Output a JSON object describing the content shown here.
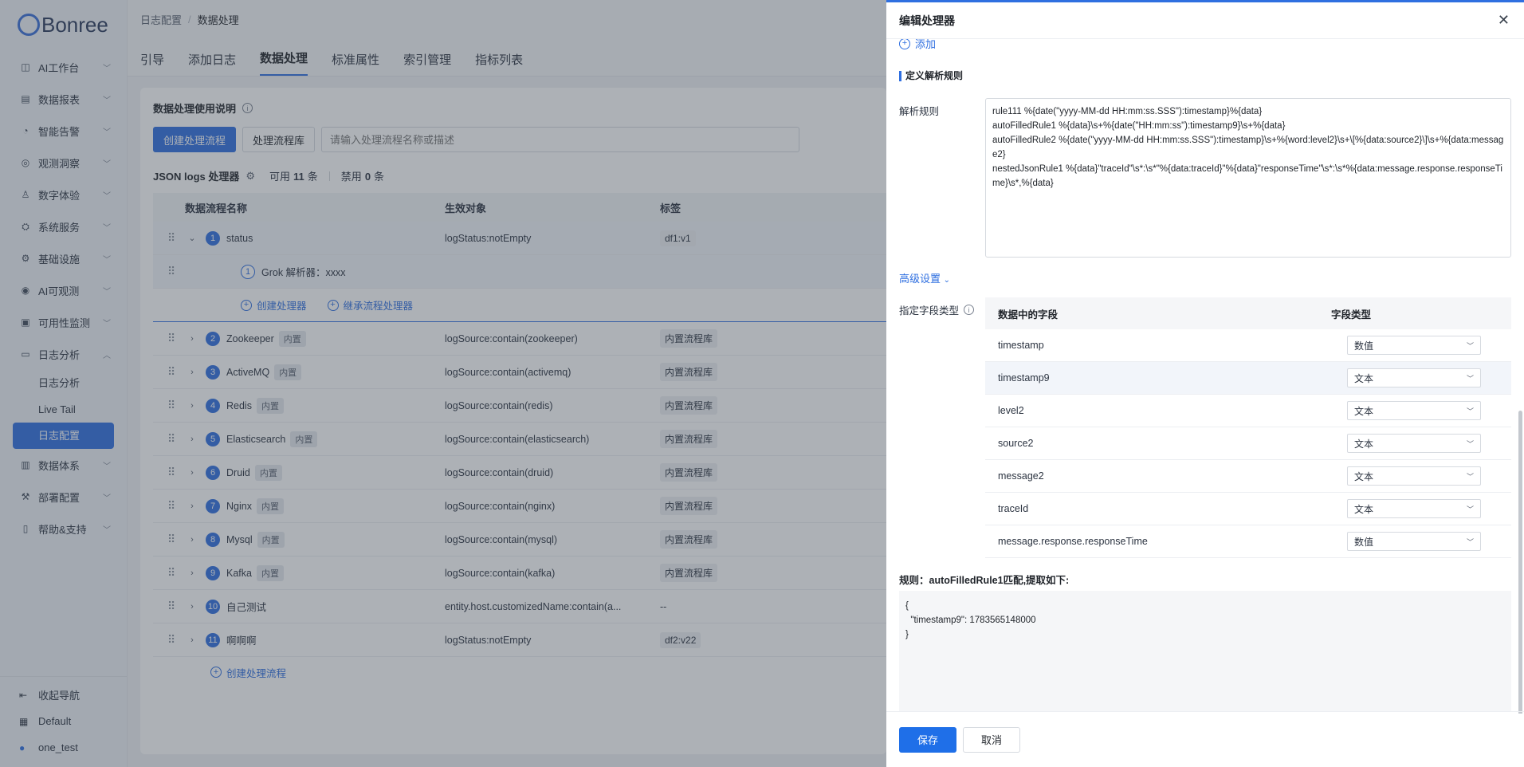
{
  "brand": "Bonree",
  "sidebar": {
    "items": [
      {
        "label": "AI工作台",
        "icon": "ai-workbench-icon"
      },
      {
        "label": "数据报表",
        "icon": "report-icon"
      },
      {
        "label": "智能告警",
        "icon": "alert-icon"
      },
      {
        "label": "观测洞察",
        "icon": "insight-icon"
      },
      {
        "label": "数字体验",
        "icon": "experience-icon"
      },
      {
        "label": "系统服务",
        "icon": "service-icon"
      },
      {
        "label": "基础设施",
        "icon": "infrastructure-icon"
      },
      {
        "label": "AI可观测",
        "icon": "ai-observe-icon"
      },
      {
        "label": "可用性监测",
        "icon": "availability-icon"
      },
      {
        "label": "日志分析",
        "icon": "log-icon"
      }
    ],
    "log_sub": [
      "日志分析",
      "Live Tail",
      "日志配置"
    ],
    "items_after": [
      {
        "label": "数据体系",
        "icon": "data-system-icon"
      },
      {
        "label": "部署配置",
        "icon": "deploy-icon"
      },
      {
        "label": "帮助&支持",
        "icon": "help-icon"
      }
    ],
    "collapse": "收起导航",
    "workspace": "Default",
    "user": "one_test"
  },
  "breadcrumb": {
    "parent": "日志配置",
    "current": "数据处理"
  },
  "tabs": [
    "引导",
    "添加日志",
    "数据处理",
    "标准属性",
    "索引管理",
    "指标列表"
  ],
  "card": {
    "title": "数据处理使用说明",
    "create_flow": "创建处理流程",
    "flow_lib": "处理流程库",
    "search_placeholder": "请输入处理流程名称或描述",
    "processor_title": "JSON logs 处理器",
    "enabled_label": "可用",
    "enabled_count": "11",
    "enabled_unit": "条",
    "disabled_label": "禁用",
    "disabled_count": "0",
    "disabled_unit": "条"
  },
  "table": {
    "headers": [
      "数据流程名称",
      "生效对象",
      "标签"
    ],
    "first": {
      "num": "1",
      "name": "status",
      "target": "logStatus:notEmpty",
      "tag": "df1:v1"
    },
    "child": {
      "num": "1",
      "name": "Grok 解析器：xxxx"
    },
    "child_actions": [
      "创建处理器",
      "继承流程处理器"
    ],
    "rows": [
      {
        "num": "2",
        "name": "Zookeeper",
        "badge": "内置",
        "target": "logSource:contain(zookeeper)",
        "tag": "内置流程库"
      },
      {
        "num": "3",
        "name": "ActiveMQ",
        "badge": "内置",
        "target": "logSource:contain(activemq)",
        "tag": "内置流程库"
      },
      {
        "num": "4",
        "name": "Redis",
        "badge": "内置",
        "target": "logSource:contain(redis)",
        "tag": "内置流程库"
      },
      {
        "num": "5",
        "name": "Elasticsearch",
        "badge": "内置",
        "target": "logSource:contain(elasticsearch)",
        "tag": "内置流程库"
      },
      {
        "num": "6",
        "name": "Druid",
        "badge": "内置",
        "target": "logSource:contain(druid)",
        "tag": "内置流程库"
      },
      {
        "num": "7",
        "name": "Nginx",
        "badge": "内置",
        "target": "logSource:contain(nginx)",
        "tag": "内置流程库"
      },
      {
        "num": "8",
        "name": "Mysql",
        "badge": "内置",
        "target": "logSource:contain(mysql)",
        "tag": "内置流程库"
      },
      {
        "num": "9",
        "name": "Kafka",
        "badge": "内置",
        "target": "logSource:contain(kafka)",
        "tag": "内置流程库"
      },
      {
        "num": "10",
        "name": "自己测试",
        "badge": "",
        "target": "entity.host.customizedName:contain(a...",
        "tag": "--"
      },
      {
        "num": "11",
        "name": "啊啊啊",
        "badge": "",
        "target": "logStatus:notEmpty",
        "tag": "df2:v22"
      }
    ],
    "create_flow": "创建处理流程"
  },
  "drawer": {
    "title": "编辑处理器",
    "add": "添加",
    "section": "定义解析规则",
    "rules_label": "解析规则",
    "rules": "rule111 %{date(\"yyyy-MM-dd HH:mm:ss.SSS\"):timestamp}%{data}\nautoFilledRule1 %{data}\\s+%{date(\"HH:mm:ss\"):timestamp9}\\s+%{data}\nautoFilledRule2 %{date(\"yyyy-MM-dd HH:mm:ss.SSS\"):timestamp}\\s+%{word:level2}\\s+\\[%{data:source2}\\]\\s+%{data:message2}\nnestedJsonRule1 %{data}\"traceId\"\\s*:\\s*\"%{data:traceId}\"%{data}\"responseTime\"\\s*:\\s*%{data:message.response.responseTime}\\s*,%{data}",
    "advanced": "高级设置",
    "field_type_label": "指定字段类型",
    "field_headers": [
      "数据中的字段",
      "字段类型"
    ],
    "fields": [
      {
        "name": "timestamp",
        "type": "数值"
      },
      {
        "name": "timestamp9",
        "type": "文本"
      },
      {
        "name": "level2",
        "type": "文本"
      },
      {
        "name": "source2",
        "type": "文本"
      },
      {
        "name": "message2",
        "type": "文本"
      },
      {
        "name": "traceId",
        "type": "文本"
      },
      {
        "name": "message.response.responseTime",
        "type": "数值"
      }
    ],
    "result_label": "规则：autoFilledRule1匹配,提取如下:",
    "result": "{\n  \"timestamp9\": 1783565148000\n}",
    "save": "保存",
    "cancel": "取消"
  }
}
